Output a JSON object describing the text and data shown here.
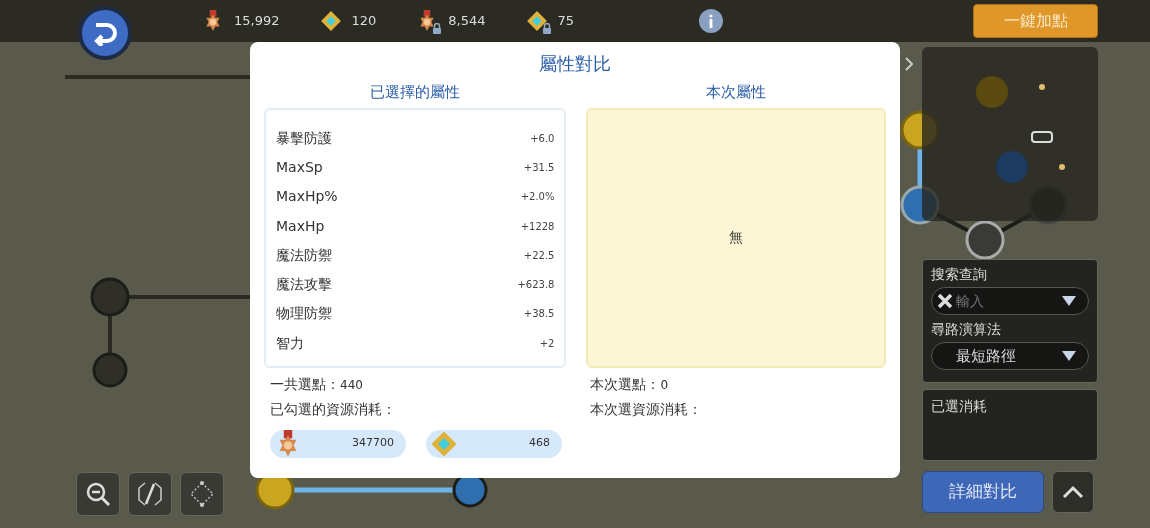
{
  "top_bar": {
    "resources": [
      {
        "kind": "medal",
        "locked": false,
        "value": "15,992"
      },
      {
        "kind": "gem",
        "locked": false,
        "value": "120"
      },
      {
        "kind": "medal",
        "locked": true,
        "value": "8,544"
      },
      {
        "kind": "gem",
        "locked": true,
        "value": "75"
      }
    ],
    "auto_button": "一鍵加點"
  },
  "dialog": {
    "title": "屬性對比",
    "left_header": "已選擇的屬性",
    "right_header": "本次屬性",
    "attributes": [
      {
        "name": "暴擊防護",
        "value": "+6.0"
      },
      {
        "name": "MaxSp",
        "value": "+31.5"
      },
      {
        "name": "MaxHp%",
        "value": "+2.0%"
      },
      {
        "name": "MaxHp",
        "value": "+1228"
      },
      {
        "name": "魔法防禦",
        "value": "+22.5"
      },
      {
        "name": "魔法攻擊",
        "value": "+623.8"
      },
      {
        "name": "物理防禦",
        "value": "+38.5"
      },
      {
        "name": "智力",
        "value": "+2"
      }
    ],
    "current_empty": "無",
    "total_label": "一共選點：",
    "total_value": "440",
    "cost_label": "已勾選的資源消耗：",
    "costs": [
      {
        "kind": "medal",
        "value": "347700"
      },
      {
        "kind": "gem",
        "value": "468"
      }
    ],
    "current_label": "本次選點：",
    "current_value": "0",
    "current_cost_label": "本次選資源消耗："
  },
  "side_panel": {
    "search_label": "搜索查詢",
    "search_placeholder": "輸入",
    "algorithm_label": "尋路演算法",
    "algorithm_value": "最短路徑",
    "cost_label": "已選消耗",
    "compare_button": "詳細對比"
  }
}
